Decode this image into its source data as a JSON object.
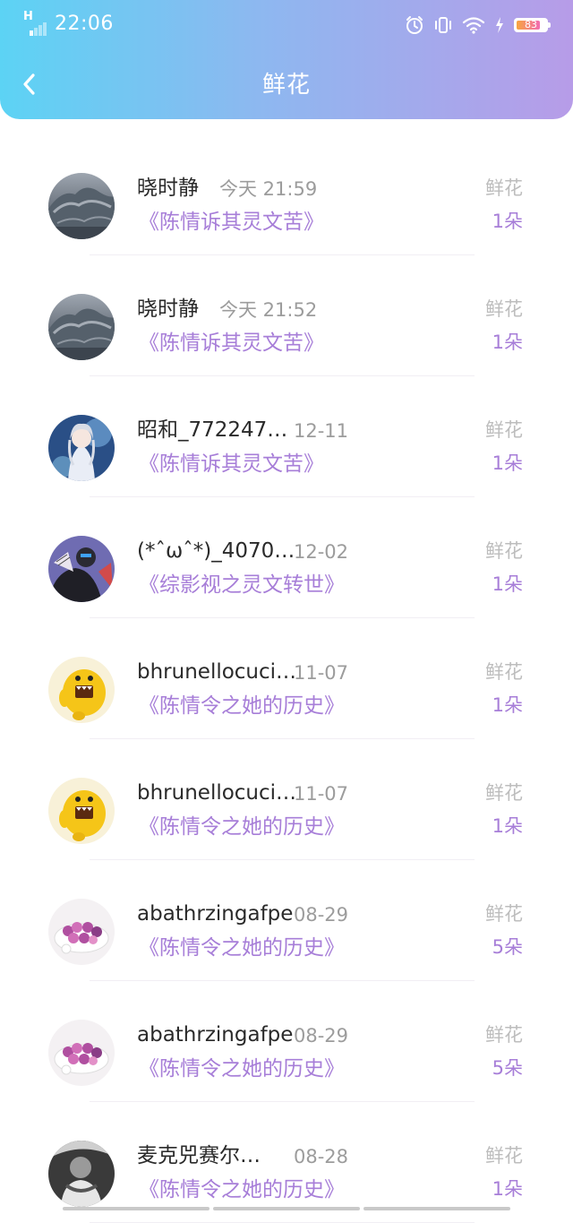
{
  "status_bar": {
    "network": "H",
    "time": "22:06",
    "battery": "83",
    "battery_level": 0.83,
    "icons": [
      "alarm-icon",
      "vibrate-icon",
      "wifi-icon",
      "charging-icon"
    ]
  },
  "header": {
    "back_icon": "chevron-left-icon",
    "title": "鲜花"
  },
  "colors": {
    "gradient_start": "#5cd3f4",
    "gradient_end": "#b79ce8",
    "accent": "#a77ed8"
  },
  "records": [
    {
      "name": "晓时静",
      "time": "今天 21:59",
      "book": "《陈情诉其灵文苦》",
      "gift": "鲜花",
      "count": "1朵",
      "avatar": "mountain-avatar"
    },
    {
      "name": "晓时静",
      "time": "今天 21:52",
      "book": "《陈情诉其灵文苦》",
      "gift": "鲜花",
      "count": "1朵",
      "avatar": "mountain-avatar"
    },
    {
      "name": "昭和_772247…",
      "time": "12-11",
      "book": "《陈情诉其灵文苦》",
      "gift": "鲜花",
      "count": "1朵",
      "avatar": "anime-girl-avatar"
    },
    {
      "name": "(*ˆωˆ*)_4070…",
      "time": "12-02",
      "book": "《综影视之灵文转世》",
      "gift": "鲜花",
      "count": "1朵",
      "avatar": "masked-figure-avatar"
    },
    {
      "name": "bhrunellocuci…",
      "time": "11-07",
      "book": "《陈情令之她的历史》",
      "gift": "鲜花",
      "count": "1朵",
      "avatar": "domo-avatar"
    },
    {
      "name": "bhrunellocuci…",
      "time": "11-07",
      "book": "《陈情令之她的历史》",
      "gift": "鲜花",
      "count": "1朵",
      "avatar": "domo-avatar"
    },
    {
      "name": "abathrzingafpe",
      "time": "08-29",
      "book": "《陈情令之她的历史》",
      "gift": "鲜花",
      "count": "5朵",
      "avatar": "dessert-avatar"
    },
    {
      "name": "abathrzingafpe",
      "time": "08-29",
      "book": "《陈情令之她的历史》",
      "gift": "鲜花",
      "count": "5朵",
      "avatar": "dessert-avatar"
    },
    {
      "name": "麦克兕赛尔…",
      "time": "08-28",
      "book": "《陈情令之她的历史》",
      "gift": "鲜花",
      "count": "1朵",
      "avatar": "bw-person-avatar"
    }
  ]
}
